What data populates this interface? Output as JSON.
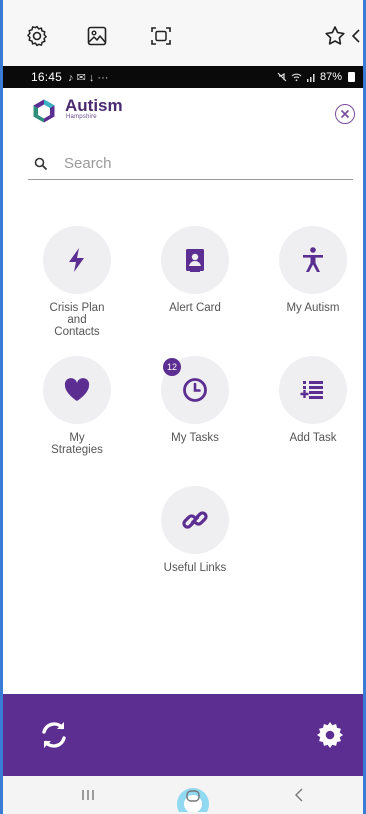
{
  "status_bar": {
    "time": "16:45",
    "notif_icons": "♪ ✉ ↓ ···",
    "battery": "87%"
  },
  "app": {
    "title": "Autism",
    "subtitle": "Hampshire"
  },
  "search": {
    "placeholder": "Search",
    "value": ""
  },
  "tiles": [
    {
      "label": "Crisis Plan and Contacts",
      "icon": "lightning-icon"
    },
    {
      "label": "Alert Card",
      "icon": "id-card-icon"
    },
    {
      "label": "My Autism",
      "icon": "person-icon"
    },
    {
      "label": "My Strategies",
      "icon": "heart-icon"
    },
    {
      "label": "My Tasks",
      "icon": "clock-icon",
      "badge": "12"
    },
    {
      "label": "Add Task",
      "icon": "list-add-icon"
    },
    {
      "label": "Useful Links",
      "icon": "link-icon"
    }
  ],
  "colors": {
    "brand_purple": "#5c2e91",
    "tile_bg": "#efeef1"
  }
}
